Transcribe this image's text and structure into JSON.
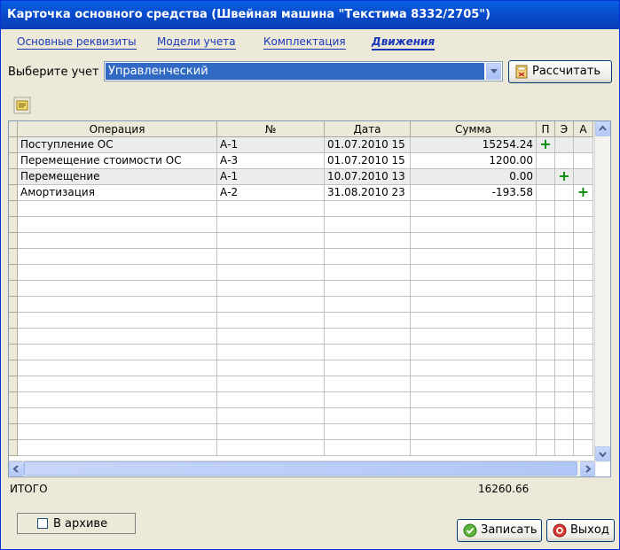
{
  "window": {
    "title": "Карточка основного средства (Швейная машина \"Текстима 8332/2705\")"
  },
  "tabs": [
    {
      "label": "Основные реквизиты",
      "active": false
    },
    {
      "label": "Модели учета",
      "active": false
    },
    {
      "label": "Комплектация",
      "active": false
    },
    {
      "label": "Движения",
      "active": true
    }
  ],
  "account": {
    "label": "Выберите учет",
    "selected": "Управленческий"
  },
  "buttons": {
    "calculate": "Рассчитать",
    "save": "Записать",
    "exit": "Выход"
  },
  "table": {
    "columns": [
      "Операция",
      "№",
      "Дата",
      "Сумма",
      "П",
      "Э",
      "А"
    ],
    "rows": [
      {
        "operation": "Поступление ОС",
        "number": "А-1",
        "date": "01.07.2010 15",
        "sum": "15254.24",
        "p": "+",
        "e": "",
        "a": ""
      },
      {
        "operation": "Перемещение стоимости ОС",
        "number": "А-3",
        "date": "01.07.2010 15",
        "sum": "1200.00",
        "p": "",
        "e": "",
        "a": ""
      },
      {
        "operation": "Перемещение",
        "number": "А-1",
        "date": "10.07.2010 13",
        "sum": "0.00",
        "p": "",
        "e": "+",
        "a": ""
      },
      {
        "operation": "Амортизация",
        "number": "А-2",
        "date": "31.08.2010 23",
        "sum": "-193.58",
        "p": "",
        "e": "",
        "a": "+"
      }
    ]
  },
  "totals": {
    "label": "ИТОГО",
    "value": "16260.66"
  },
  "archive": {
    "label": "В архиве",
    "checked": false
  },
  "colors": {
    "titlebar": "#0a5fe3",
    "selection": "#316ac5",
    "link": "#1a36b8",
    "plus": "#0a8a0a"
  }
}
